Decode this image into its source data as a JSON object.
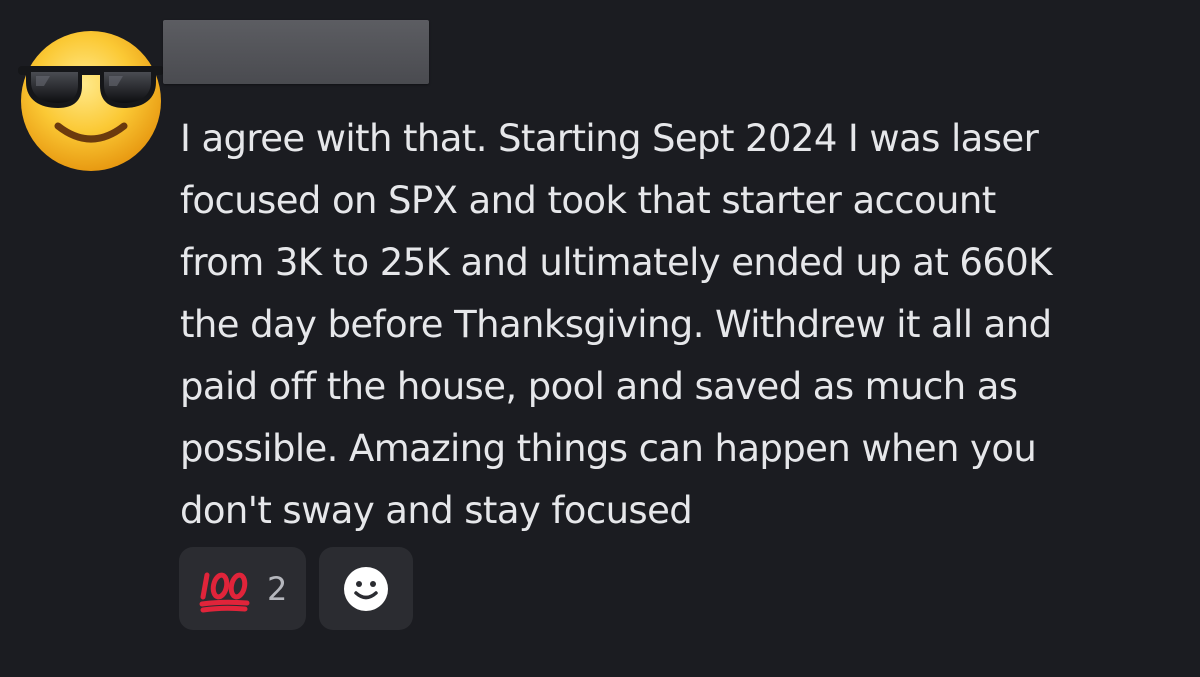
{
  "message": {
    "author": {
      "name": "",
      "avatar_icon": "sunglasses-smiley-emoji-icon"
    },
    "text": "I agree with that.  Starting Sept 2024 I was laser\nfocused on SPX and took that starter account\nfrom 3K to 25K and ultimately ended up at 660K\nthe day before Thanksgiving.  Withdrew it all and\npaid off the house, pool and saved as much as\npossible.  Amazing things can happen when you\ndon't sway and stay focused"
  },
  "reactions": [
    {
      "emoji_icon": "hundred-points-emoji-icon",
      "count": "2"
    }
  ],
  "add_reaction": {
    "icon": "add-reaction-smiley-icon"
  },
  "colors": {
    "background": "#1b1c21",
    "text": "#e6e7ea",
    "reaction_bg": "#2b2c31",
    "count": "#b5b7bd",
    "hundred_red": "#e0243a"
  }
}
